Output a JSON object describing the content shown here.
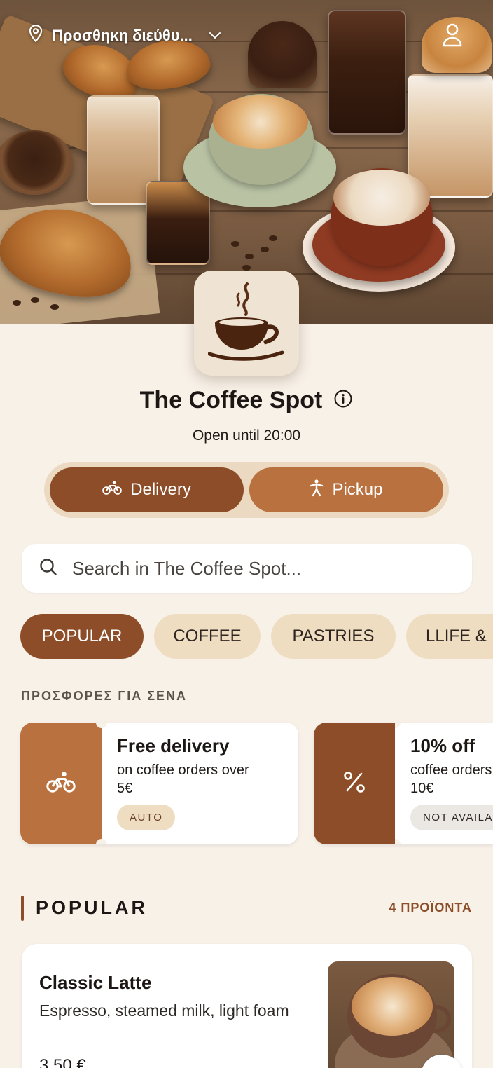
{
  "header": {
    "location_text": "Προσθηκη διεύθυ...",
    "icons": {
      "location": "map-pin-icon",
      "dropdown": "chevron-down-icon",
      "account": "user-icon"
    }
  },
  "store": {
    "name": "The Coffee Spot",
    "status": "Open until 20:00",
    "logo_icon": "coffee-cup-icon",
    "info_icon": "info-icon"
  },
  "mode": {
    "options": [
      {
        "label": "Delivery",
        "icon": "bicycle-icon",
        "selected": true
      },
      {
        "label": "Pickup",
        "icon": "walking-person-icon",
        "selected": false
      }
    ]
  },
  "search": {
    "placeholder": "Search in The Coffee Spot..."
  },
  "categories": {
    "items": [
      {
        "label": "POPULAR",
        "selected": true
      },
      {
        "label": "COFFEE",
        "selected": false
      },
      {
        "label": "PASTRIES",
        "selected": false
      },
      {
        "label": "LLIFE &",
        "selected": false
      }
    ]
  },
  "offers": {
    "heading": "ΠΡΟΣΦΟΡΕΣ ΓΙΑ ΣΕΝΑ",
    "items": [
      {
        "title": "Free delivery",
        "desc_line1": "on coffee orders over",
        "desc_line2": "5€",
        "badge": "AUTO",
        "icon": "bicycle-icon",
        "color": "#b8713f"
      },
      {
        "title": "10% off",
        "desc_line1": "coffee orders",
        "desc_line2": "10€",
        "badge": "NOT AVAILABLE",
        "icon": "percent-icon",
        "color": "#8d4d28"
      }
    ]
  },
  "popular": {
    "title": "POPULAR",
    "count": "4 ΠΡΟΪΟΝΤΑ",
    "products": [
      {
        "name": "Classic Latte",
        "description": "Espresso, steamed milk, light foam",
        "price": "3,50 €"
      }
    ]
  },
  "colors": {
    "background": "#f8f1e8",
    "primary": "#8d4d28",
    "secondary": "#b8713f",
    "chip_inactive": "#efddc2"
  }
}
